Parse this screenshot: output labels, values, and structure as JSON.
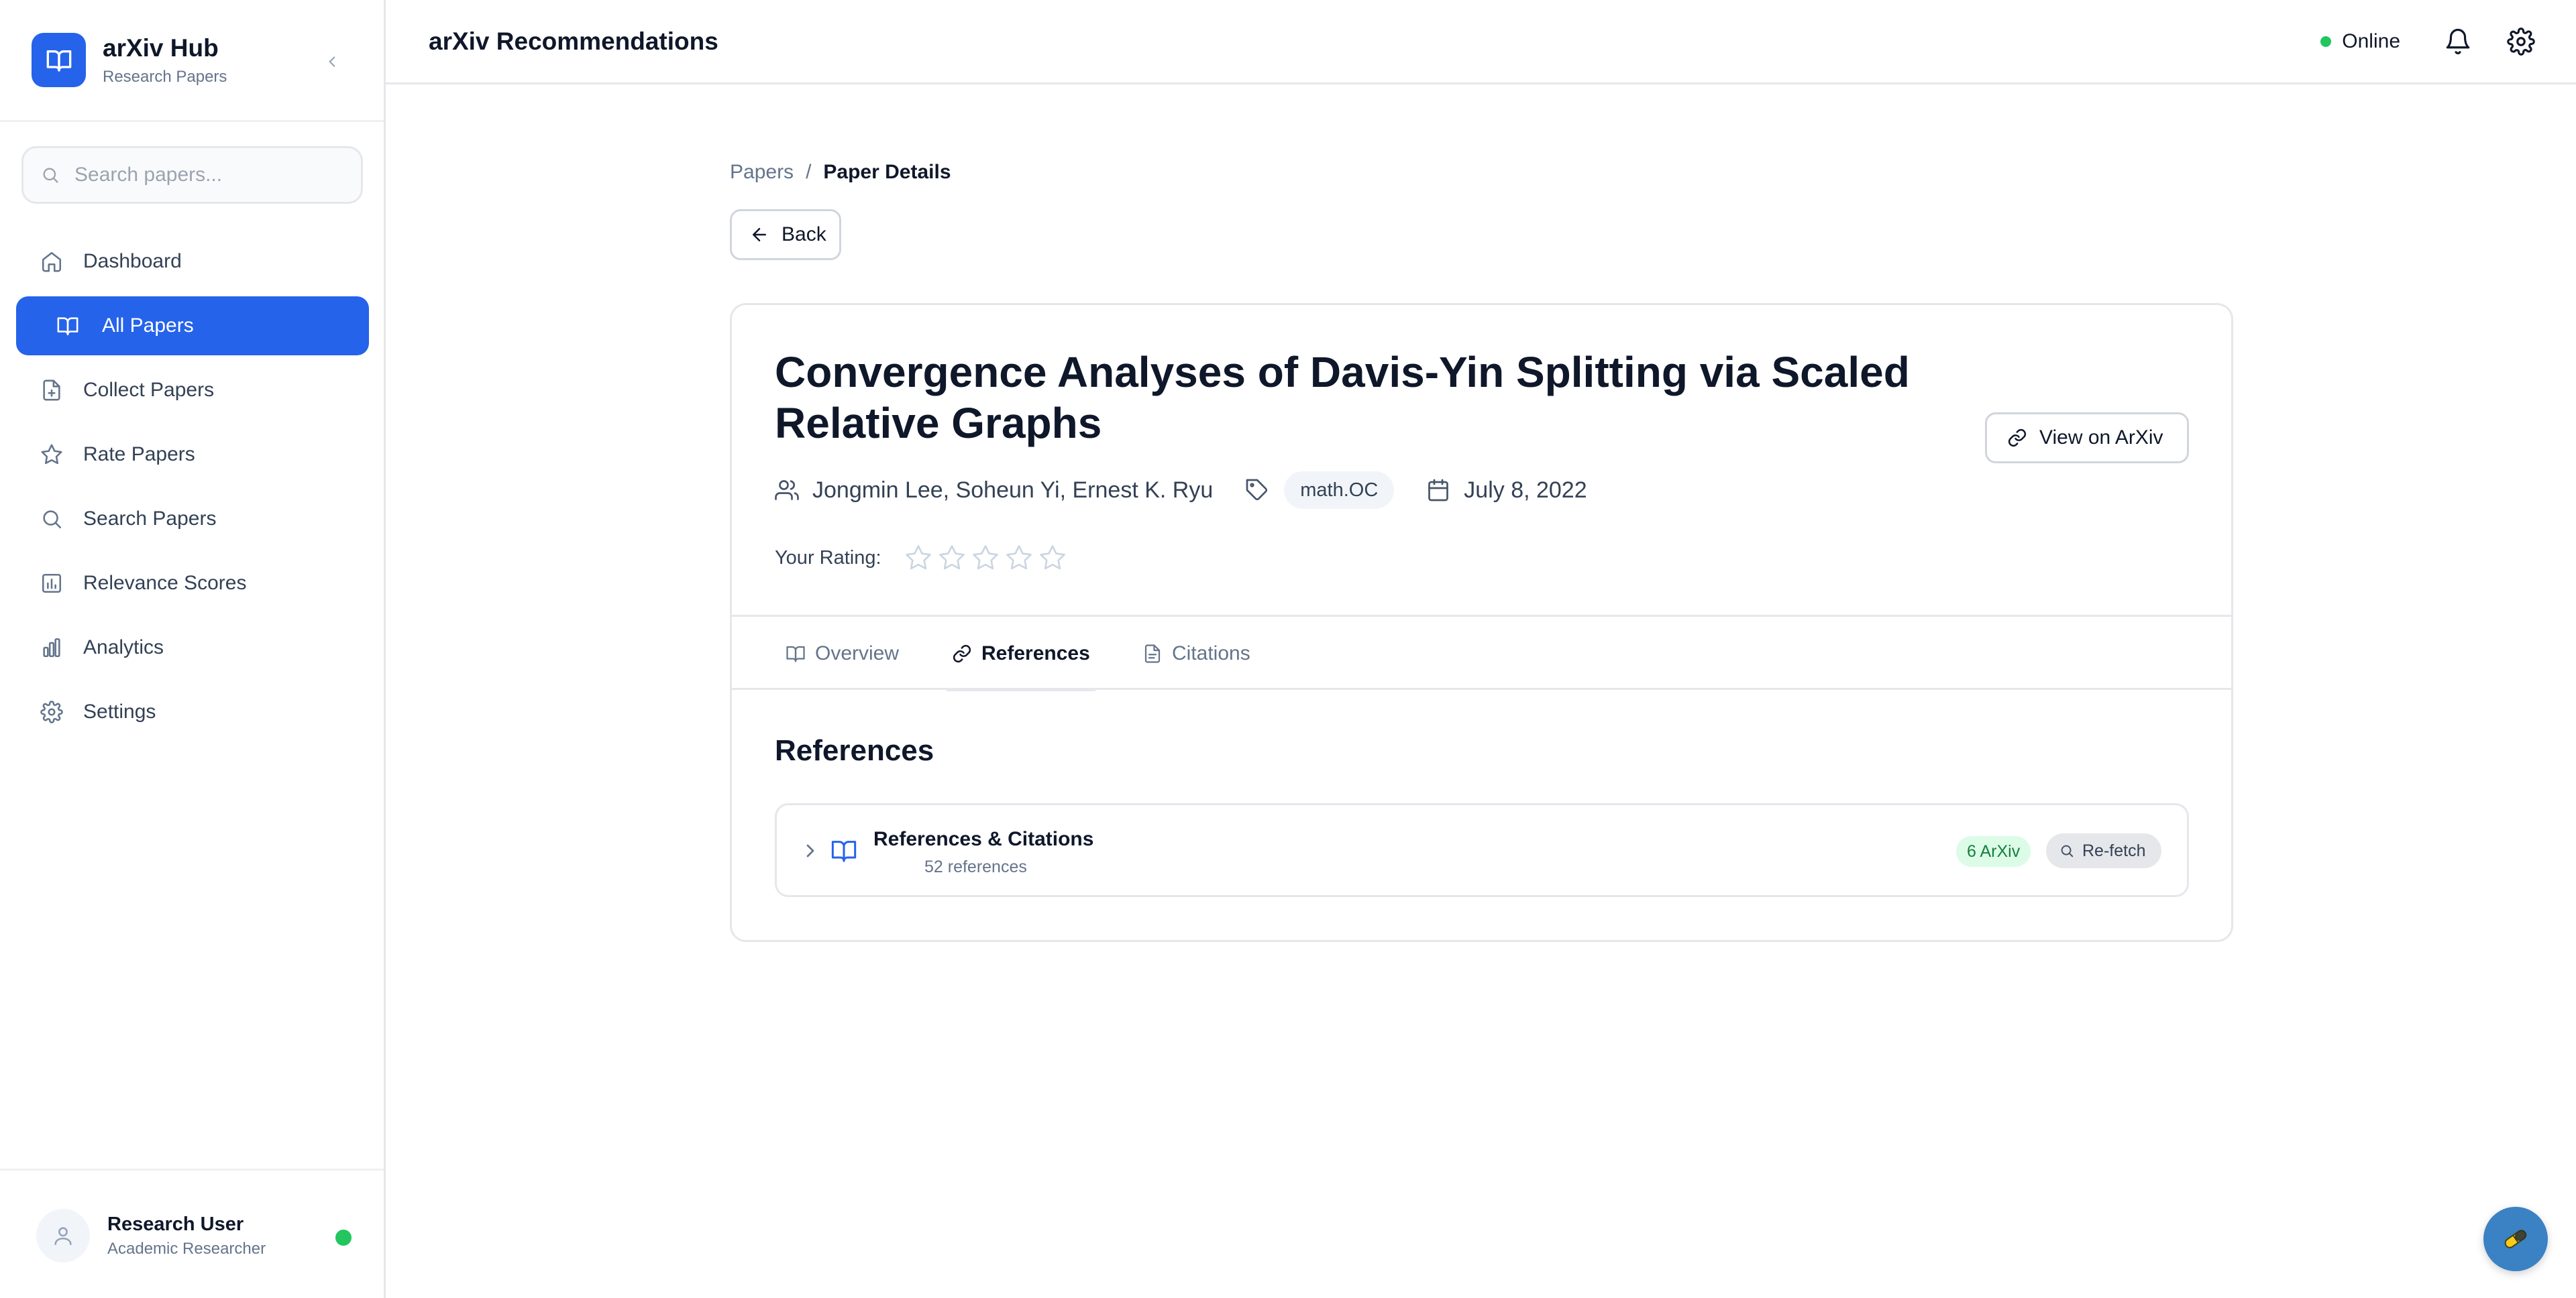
{
  "sidebar": {
    "brand_title": "arXiv Hub",
    "brand_subtitle": "Research Papers",
    "search_placeholder": "Search papers...",
    "items": [
      {
        "label": "Dashboard",
        "icon": "home-icon"
      },
      {
        "label": "All Papers",
        "icon": "book-icon",
        "active": true
      },
      {
        "label": "Collect Papers",
        "icon": "file-plus-icon"
      },
      {
        "label": "Rate Papers",
        "icon": "star-icon"
      },
      {
        "label": "Search Papers",
        "icon": "search-icon"
      },
      {
        "label": "Relevance Scores",
        "icon": "bar-chart-icon"
      },
      {
        "label": "Analytics",
        "icon": "analytics-icon"
      },
      {
        "label": "Settings",
        "icon": "gear-icon"
      }
    ],
    "user": {
      "name": "Research User",
      "role": "Academic Researcher"
    }
  },
  "header": {
    "title": "arXiv Recommendations",
    "status": "Online"
  },
  "breadcrumb": {
    "parent": "Papers",
    "separator": "/",
    "current": "Paper Details"
  },
  "back_label": "Back",
  "paper": {
    "title": "Convergence Analyses of Davis-Yin Splitting via Scaled Relative Graphs",
    "authors": "Jongmin Lee, Soheun Yi, Ernest K. Ryu",
    "category": "math.OC",
    "date": "July 8, 2022",
    "view_label": "View on ArXiv",
    "rating_label": "Your Rating:",
    "rating_value": 0,
    "rating_max": 5
  },
  "tabs": [
    {
      "label": "Overview",
      "icon": "book-icon"
    },
    {
      "label": "References",
      "icon": "link-icon",
      "active": true
    },
    {
      "label": "Citations",
      "icon": "file-icon"
    }
  ],
  "references": {
    "section_title": "References",
    "group_title": "References & Citations",
    "count_text": "52 references",
    "arxiv_badge": "6 ArXiv",
    "refetch_label": "Re-fetch"
  },
  "colors": {
    "accent": "#2563eb",
    "online": "#22c55e",
    "badge_bg": "#dcfce7",
    "badge_text": "#15803d",
    "fab": "#3b82c4"
  }
}
